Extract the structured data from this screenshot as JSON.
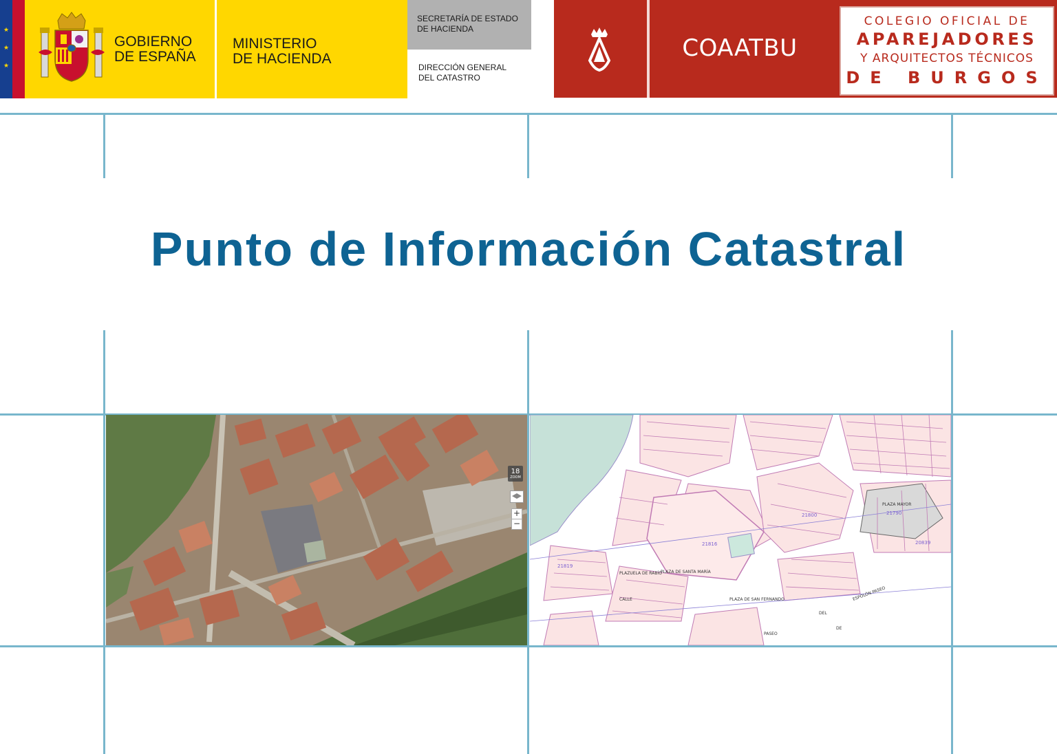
{
  "header": {
    "gobierno_text": "GOBIERNO\nDE ESPAÑA",
    "ministerio_text": "MINISTERIO\nDE HACIENDA",
    "secretaria_text": "SECRETARÍA DE ESTADO\nDE HACIENDA",
    "direccion_text": "DIRECCIÓN GENERAL\nDEL CATASTRO",
    "coaatbu_name": "COAATBU",
    "colegio_line1": "COLEGIO OFICIAL DE",
    "colegio_line2": "APAREJADORES",
    "colegio_line3": "Y ARQUITECTOS TÉCNICOS",
    "colegio_line4": "DE BURGOS"
  },
  "title": "Punto de Información Catastral",
  "aerial_map": {
    "zoom_level": "18",
    "zoom_label": "ZOOM",
    "zoom_in": "+",
    "zoom_out": "−"
  },
  "cadastral_map": {
    "street_labels": [
      "CALLE",
      "PLAZA MAYOR",
      "PLAZA DE SAN FERNANDO",
      "ESPOLÓN PASEO",
      "PLAZA DE SANTA MARÍA",
      "PLAZUELA DE RABÍO",
      "PASEO",
      "DEL",
      "DE"
    ],
    "parcel_labels": [
      "21816",
      "21790",
      "21800",
      "21819",
      "20839"
    ]
  },
  "colors": {
    "gob_yellow": "#ffd700",
    "coa_red": "#b82a1d",
    "title_blue": "#0e6393",
    "grid_line": "#78b6cc"
  }
}
